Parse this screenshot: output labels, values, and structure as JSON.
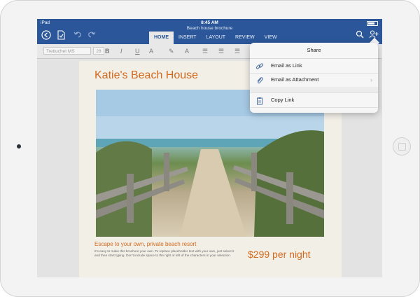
{
  "status": {
    "device": "iPad",
    "time": "8:45 AM"
  },
  "app": {
    "doc_title": "Beach house brochure"
  },
  "toolbar": {
    "back_icon": "back-arrow-icon",
    "save_icon": "document-save-icon",
    "undo_icon": "undo-icon",
    "redo_icon": "redo-icon",
    "search_icon": "search-icon",
    "share_icon": "add-person-icon"
  },
  "tabs": [
    {
      "label": "HOME",
      "active": true
    },
    {
      "label": "INSERT",
      "active": false
    },
    {
      "label": "LAYOUT",
      "active": false
    },
    {
      "label": "REVIEW",
      "active": false
    },
    {
      "label": "VIEW",
      "active": false
    }
  ],
  "ribbon": {
    "font": "Trebuchet MS",
    "size": "28"
  },
  "share": {
    "title": "Share",
    "items": [
      {
        "label": "Email as Link",
        "icon": "link-icon"
      },
      {
        "label": "Email as Attachment",
        "icon": "paperclip-icon"
      },
      {
        "label": "Copy Link",
        "icon": "clipboard-icon"
      }
    ]
  },
  "document": {
    "heading": "Katie's Beach House",
    "subheading": "Escape to your own, private beach resort",
    "body": "It's easy to make this brochure your own. To replace placeholder text with your own, just select it and then start typing. Don't include space to the right or left of the characters in your selection.",
    "price": "$299 per night"
  },
  "colors": {
    "title_bar": "#2b579a",
    "accent": "#d26a1e"
  }
}
